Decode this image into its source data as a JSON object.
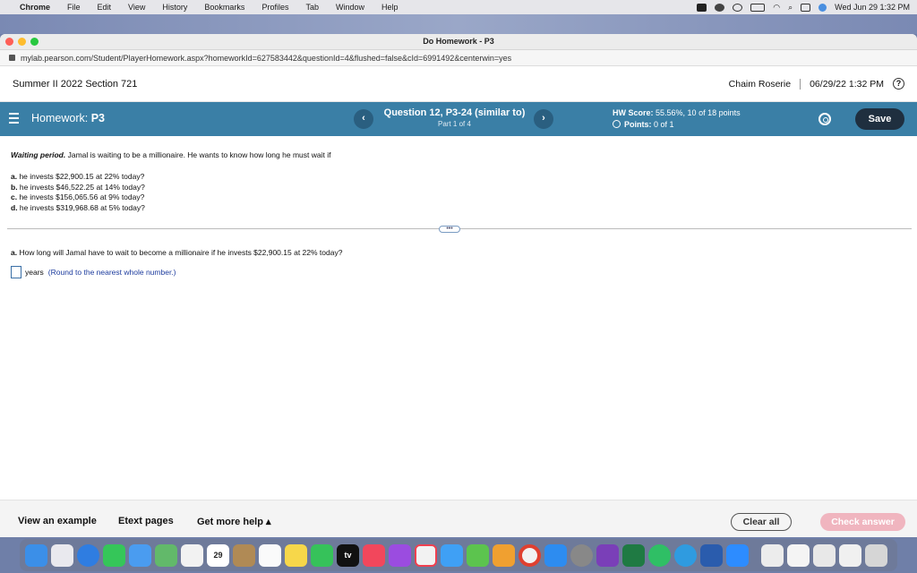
{
  "menubar": {
    "app": "Chrome",
    "items": [
      "File",
      "Edit",
      "View",
      "History",
      "Bookmarks",
      "Profiles",
      "Tab",
      "Window",
      "Help"
    ],
    "clock": "Wed Jun 29  1:32 PM"
  },
  "window": {
    "title": "Do Homework - P3",
    "url": "mylab.pearson.com/Student/PlayerHomework.aspx?homeworkId=627583442&questionId=4&flushed=false&cId=6991492&centerwin=yes"
  },
  "course": {
    "name": "Summer II 2022 Section 721",
    "user": "Chaim Roserie",
    "datetime": "06/29/22 1:32 PM",
    "help": "?"
  },
  "hwbar": {
    "label": "Homework:",
    "name": "P3",
    "prev": "‹",
    "next": "›",
    "question": "Question 12, P3-24 (similar to)",
    "part": "Part 1 of 4",
    "score_label": "HW Score:",
    "score_value": "55.56%, 10 of 18 points",
    "points_label": "Points:",
    "points_value": "0 of 1",
    "save": "Save"
  },
  "problem": {
    "title": "Waiting period.",
    "text": " Jamal is waiting to be a millionaire.  He wants to know how long he must wait if",
    "items": [
      {
        "letter": "a.",
        "text": " he invests $22,900.15 at 22% today?"
      },
      {
        "letter": "b.",
        "text": " he invests $46,522.25 at 14% today?"
      },
      {
        "letter": "c.",
        "text": " he invests $156,065.56 at 9% today?"
      },
      {
        "letter": "d.",
        "text": " he invests $319,968.68 at 5% today?"
      }
    ],
    "more": "•••"
  },
  "question": {
    "letter": "a.",
    "text": " How long will Jamal have to wait to become a millionaire if he invests $22,900.15 at 22% today?",
    "unit": "years",
    "hint": "(Round to the nearest whole number.)"
  },
  "footer": {
    "example": "View an example",
    "etext": "Etext pages",
    "help": "Get more help ▴",
    "clear": "Clear all",
    "check": "Check answer"
  },
  "dock": {
    "calendar_day": "29",
    "tv_label": "tv"
  }
}
